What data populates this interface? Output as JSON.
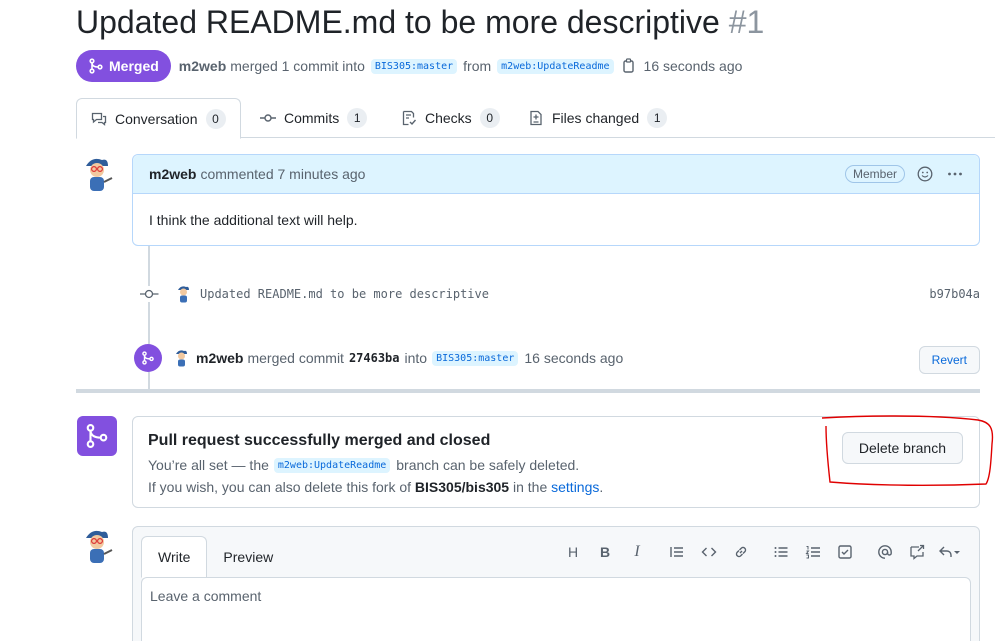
{
  "pr": {
    "title": "Updated README.md to be more descriptive",
    "number": "#1",
    "state": "Merged",
    "author": "m2web",
    "summary_merged": "merged 1 commit into",
    "base_branch": "BIS305:master",
    "from_word": "from",
    "head_branch": "m2web:UpdateReadme",
    "time": "16 seconds ago"
  },
  "tabs": [
    {
      "label": "Conversation",
      "count": "0",
      "icon": "comment-discussion-icon"
    },
    {
      "label": "Commits",
      "count": "1",
      "icon": "git-commit-icon"
    },
    {
      "label": "Checks",
      "count": "0",
      "icon": "checklist-icon"
    },
    {
      "label": "Files changed",
      "count": "1",
      "icon": "file-diff-icon"
    }
  ],
  "comment": {
    "author": "m2web",
    "meta": "commented 7 minutes ago",
    "badge": "Member",
    "body": "I think the additional text will help."
  },
  "commit": {
    "message": "Updated README.md to be more descriptive",
    "sha": "b97b04a"
  },
  "merge_event": {
    "author": "m2web",
    "text1": "merged commit",
    "sha": "27463ba",
    "text2": "into",
    "branch": "BIS305:master",
    "time": "16 seconds ago",
    "revert_label": "Revert"
  },
  "merge_box": {
    "heading": "Pull request successfully merged and closed",
    "line1_pre": "You’re all set — the",
    "line1_branch": "m2web:UpdateReadme",
    "line1_post": "branch can be safely deleted.",
    "line2_pre": "If you wish, you can also delete this fork of",
    "line2_repo": "BIS305/bis305",
    "line2_mid": "in the",
    "line2_link": "settings",
    "line2_end": ".",
    "delete_label": "Delete branch"
  },
  "editor": {
    "tab_write": "Write",
    "tab_preview": "Preview",
    "placeholder": "Leave a comment",
    "toolbar": [
      "heading-icon",
      "bold-icon",
      "italic-icon",
      "quote-icon",
      "code-icon",
      "link-icon",
      "unordered-list-icon",
      "ordered-list-icon",
      "task-list-icon",
      "mention-icon",
      "cross-reference-icon",
      "reply-icon"
    ]
  },
  "colors": {
    "merged_purple": "#8250df",
    "link_blue": "#0969da",
    "annotation_red": "#e00000"
  }
}
